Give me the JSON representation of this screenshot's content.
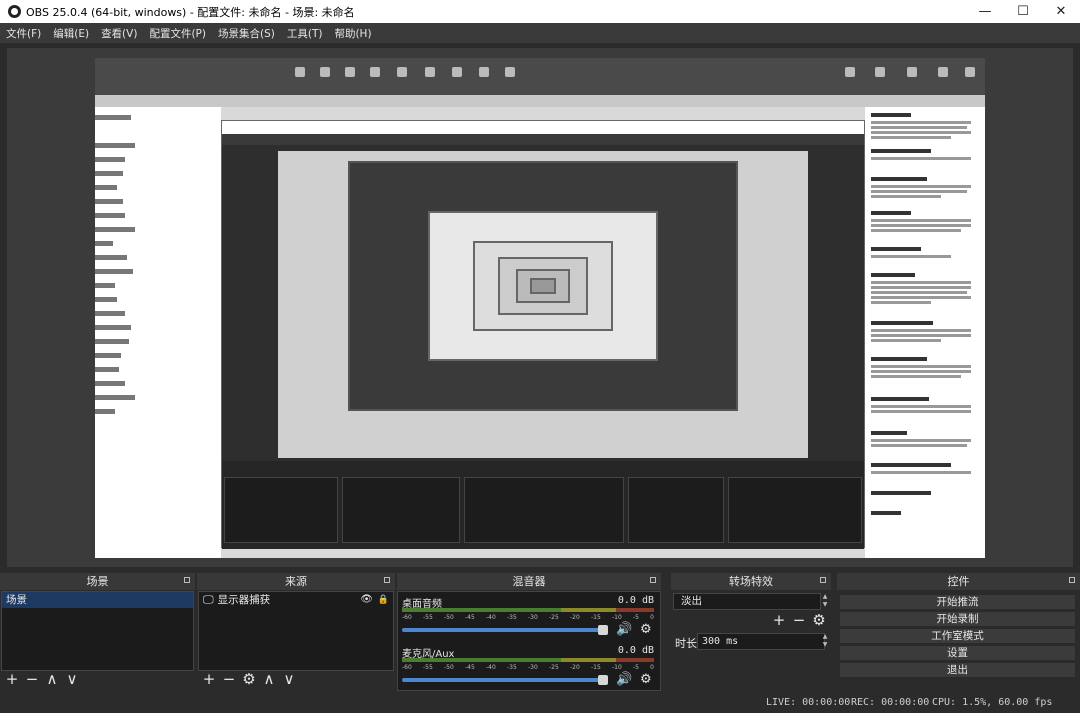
{
  "window": {
    "title": "OBS 25.0.4 (64-bit, windows) - 配置文件: 未命名 - 场景: 未命名",
    "minimize": "—",
    "maximize": "☐",
    "close": "✕"
  },
  "menu": [
    "文件(F)",
    "编辑(E)",
    "查看(V)",
    "配置文件(P)",
    "场景集合(S)",
    "工具(T)",
    "帮助(H)"
  ],
  "docks": {
    "scenes": {
      "title": "场景",
      "items": [
        "场景"
      ]
    },
    "sources": {
      "title": "来源",
      "items": [
        "显示器捕获"
      ]
    },
    "mixer": {
      "title": "混音器",
      "channels": [
        {
          "name": "桌面音频",
          "db": "0.0 dB"
        },
        {
          "name": "麦克风/Aux",
          "db": "0.0 dB"
        }
      ],
      "ticks": [
        "-60",
        "-55",
        "-50",
        "-45",
        "-40",
        "-35",
        "-30",
        "-25",
        "-20",
        "-15",
        "-10",
        "-5",
        "0"
      ]
    },
    "transitions": {
      "title": "转场特效",
      "selected": "淡出",
      "duration_label": "时长",
      "duration_value": "300 ms"
    },
    "controls": {
      "title": "控件",
      "buttons": [
        "开始推流",
        "开始录制",
        "工作室模式",
        "设置",
        "退出"
      ]
    }
  },
  "status": {
    "live": "LIVE: 00:00:00",
    "rec": "REC: 00:00:00",
    "cpu": "CPU: 1.5%, 60.00 fps"
  },
  "icons": {
    "add": "+",
    "remove": "−",
    "up": "∧",
    "down": "∨",
    "gear": "⚙",
    "eye": "👁",
    "lock": "🔒",
    "volume": "🔊",
    "monitor": "🖵"
  }
}
